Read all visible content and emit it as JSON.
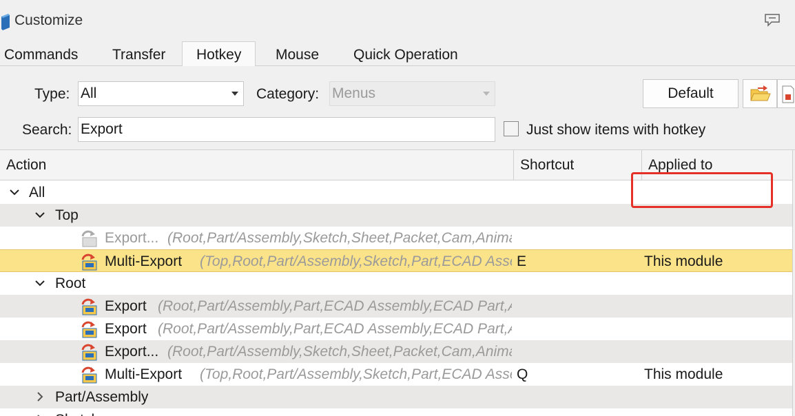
{
  "window": {
    "title": "Customize"
  },
  "tabs": [
    "Commands",
    "Transfer",
    "Hotkey",
    "Mouse",
    "Quick Operation"
  ],
  "active_tab": "Hotkey",
  "filters": {
    "type_label": "Type:",
    "type_value": "All",
    "category_label": "Category:",
    "category_value": "Menus",
    "search_label": "Search:",
    "search_value": "Export",
    "checkbox_label": "Just show items with hotkey",
    "default_button": "Default"
  },
  "columns": {
    "action": "Action",
    "shortcut": "Shortcut",
    "applied": "Applied to"
  },
  "tree": [
    {
      "label": "All",
      "path": "",
      "shortcut": "",
      "applied": ""
    },
    {
      "label": "Top",
      "path": "",
      "shortcut": "",
      "applied": ""
    },
    {
      "label": "Export...",
      "path": "(Root,Part/Assembly,Sketch,Sheet,Packet,Cam,Anima",
      "shortcut": "",
      "applied": ""
    },
    {
      "label": "Multi-Export",
      "path": "(Top,Root,Part/Assembly,Sketch,Part,ECAD Asse",
      "shortcut": "E",
      "applied": "This module"
    },
    {
      "label": "Root",
      "path": "",
      "shortcut": "",
      "applied": ""
    },
    {
      "label": "Export",
      "path": "(Root,Part/Assembly,Part,ECAD Assembly,ECAD Part,A",
      "shortcut": "",
      "applied": ""
    },
    {
      "label": "Export",
      "path": "(Root,Part/Assembly,Part,ECAD Assembly,ECAD Part,A",
      "shortcut": "",
      "applied": ""
    },
    {
      "label": "Export...",
      "path": "(Root,Part/Assembly,Sketch,Sheet,Packet,Cam,Anima",
      "shortcut": "",
      "applied": ""
    },
    {
      "label": "Multi-Export",
      "path": "(Top,Root,Part/Assembly,Sketch,Part,ECAD Asse",
      "shortcut": "Q",
      "applied": "This module"
    },
    {
      "label": "Part/Assembly",
      "path": "",
      "shortcut": "",
      "applied": ""
    },
    {
      "label": "Sketch",
      "path": "",
      "shortcut": "",
      "applied": ""
    }
  ],
  "icons": {
    "app": "app-cube-icon",
    "feedback": "speech-bubble-icon",
    "import": "folder-import-icon",
    "export_doc": "document-icon",
    "export_item": "export-arrow-icon"
  },
  "colors": {
    "selected_row": "#fbe38a",
    "highlight_box": "#e53027"
  }
}
